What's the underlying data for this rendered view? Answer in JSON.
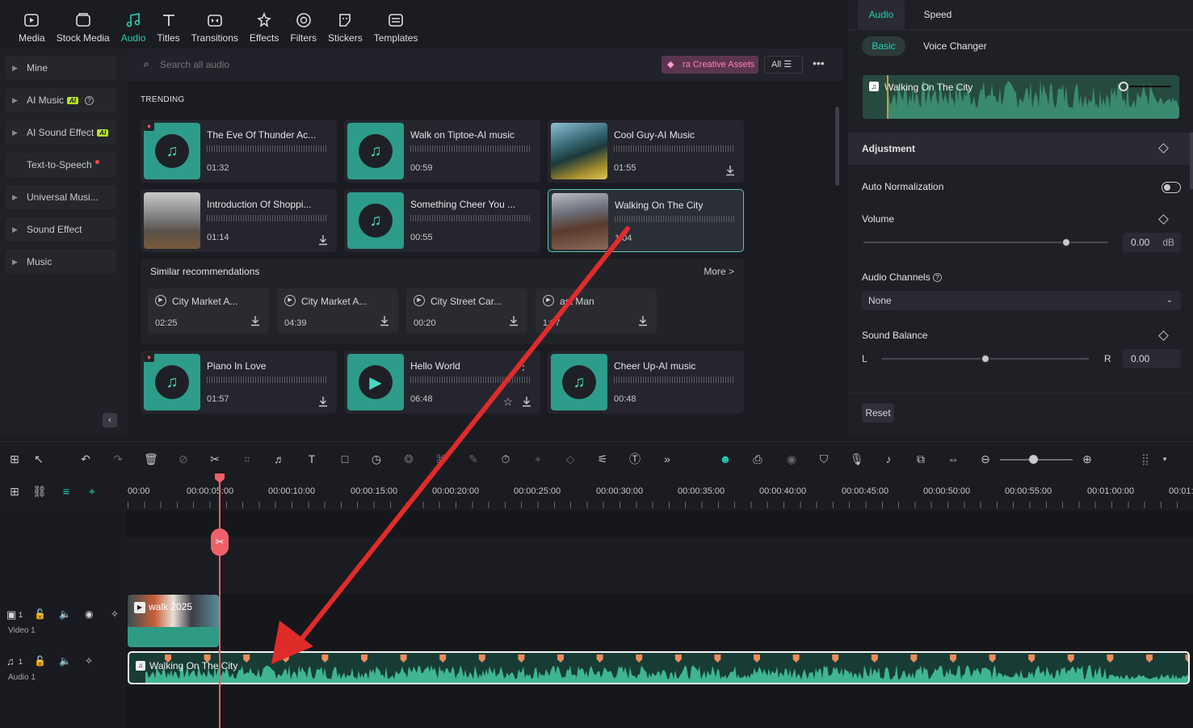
{
  "top_tabs": [
    {
      "label": "Media",
      "icon": "media-icon"
    },
    {
      "label": "Stock Media",
      "icon": "stock-media-icon"
    },
    {
      "label": "Audio",
      "icon": "audio-icon",
      "active": true
    },
    {
      "label": "Titles",
      "icon": "titles-icon"
    },
    {
      "label": "Transitions",
      "icon": "transitions-icon"
    },
    {
      "label": "Effects",
      "icon": "effects-icon"
    },
    {
      "label": "Filters",
      "icon": "filters-icon"
    },
    {
      "label": "Stickers",
      "icon": "stickers-icon"
    },
    {
      "label": "Templates",
      "icon": "templates-icon"
    }
  ],
  "sidebar": {
    "items": [
      {
        "label": "Mine"
      },
      {
        "label": "AI Music",
        "badge": "AI"
      },
      {
        "label": "AI Sound Effect",
        "badge": "AI"
      },
      {
        "label": "Text-to-Speech"
      },
      {
        "label": "Universal Musi..."
      },
      {
        "label": "Sound Effect"
      },
      {
        "label": "Music"
      }
    ]
  },
  "search": {
    "placeholder": "Search all audio",
    "promo": "ra Creative Assets",
    "filter": "All"
  },
  "trending_label": "TRENDING",
  "cards_row1": [
    {
      "title": "The Eve Of Thunder Ac...",
      "time": "01:32"
    },
    {
      "title": "Walk on Tiptoe-AI music",
      "time": "00:59"
    },
    {
      "title": "Cool Guy-AI Music",
      "time": "01:55"
    }
  ],
  "cards_row2": [
    {
      "title": "Introduction Of Shoppi...",
      "time": "01:14"
    },
    {
      "title": "Something Cheer You ...",
      "time": "00:55"
    },
    {
      "title": "Walking On The City",
      "time": "1:04"
    }
  ],
  "similar": {
    "label": "Similar recommendations",
    "more": "More >",
    "items": [
      {
        "title": "City Market A...",
        "time": "02:25"
      },
      {
        "title": "City Market A...",
        "time": "04:39"
      },
      {
        "title": "City Street Car...",
        "time": "00:20"
      },
      {
        "title": "ast Man",
        "time": "1:07"
      }
    ]
  },
  "cards_row3": [
    {
      "title": "Piano In Love",
      "time": "01:57"
    },
    {
      "title": "Hello World",
      "time": "06:48"
    },
    {
      "title": "Cheer Up-AI music",
      "time": "00:48"
    }
  ],
  "right_panel": {
    "tabs": [
      "Audio",
      "Speed"
    ],
    "subtabs": [
      "Basic",
      "Voice Changer"
    ],
    "preview_title": "Walking On The City",
    "adjustment": "Adjustment",
    "auto_norm": "Auto Normalization",
    "volume": "Volume",
    "volume_value": "0.00",
    "volume_unit": "dB",
    "channels": "Audio Channels",
    "channels_value": "None",
    "balance": "Sound Balance",
    "balance_l": "L",
    "balance_r": "R",
    "balance_value": "0.00",
    "reset": "Reset"
  },
  "ruler_ticks": [
    "00:00",
    "00:00:05:00",
    "00:00:10:00",
    "00:00:15:00",
    "00:00:20:00",
    "00:00:25:00",
    "00:00:30:00",
    "00:00:35:00",
    "00:00:40:00",
    "00:00:45:00",
    "00:00:50:00",
    "00:00:55:00",
    "00:01:00:00",
    "00:01:"
  ],
  "tracks": {
    "video_label": "Video 1",
    "audio_label": "Audio 1",
    "video_num": "1",
    "audio_num": "1",
    "video_clip": "walk 2025",
    "audio_clip": "Walking On The City"
  },
  "colors": {
    "accent": "#22d3b4",
    "arrow": "#e02b2b",
    "playhead": "#f0606a",
    "wave": "#3fb593"
  }
}
